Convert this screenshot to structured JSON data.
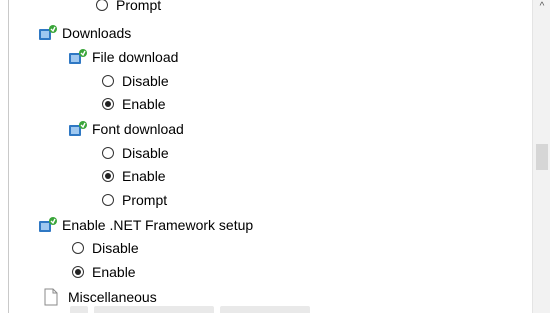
{
  "tree": {
    "top_partial_label": "Prompt",
    "downloads": {
      "label": "Downloads",
      "file_download": {
        "label": "File download",
        "options": [
          "Disable",
          "Enable"
        ],
        "selected": "Enable"
      },
      "font_download": {
        "label": "Font download",
        "options": [
          "Disable",
          "Enable",
          "Prompt"
        ],
        "selected": "Enable"
      }
    },
    "enable_net_framework_setup": {
      "label": "Enable .NET Framework setup",
      "options": [
        "Disable",
        "Enable"
      ],
      "selected": "Enable"
    },
    "miscellaneous": {
      "label": "Miscellaneous"
    }
  },
  "colors": {
    "background": "#ffffff",
    "border": "#c9c9c9",
    "scroll_thumb": "#d6d6d6",
    "icon_blue": "#2f78c4",
    "icon_green": "#3aa53a"
  }
}
